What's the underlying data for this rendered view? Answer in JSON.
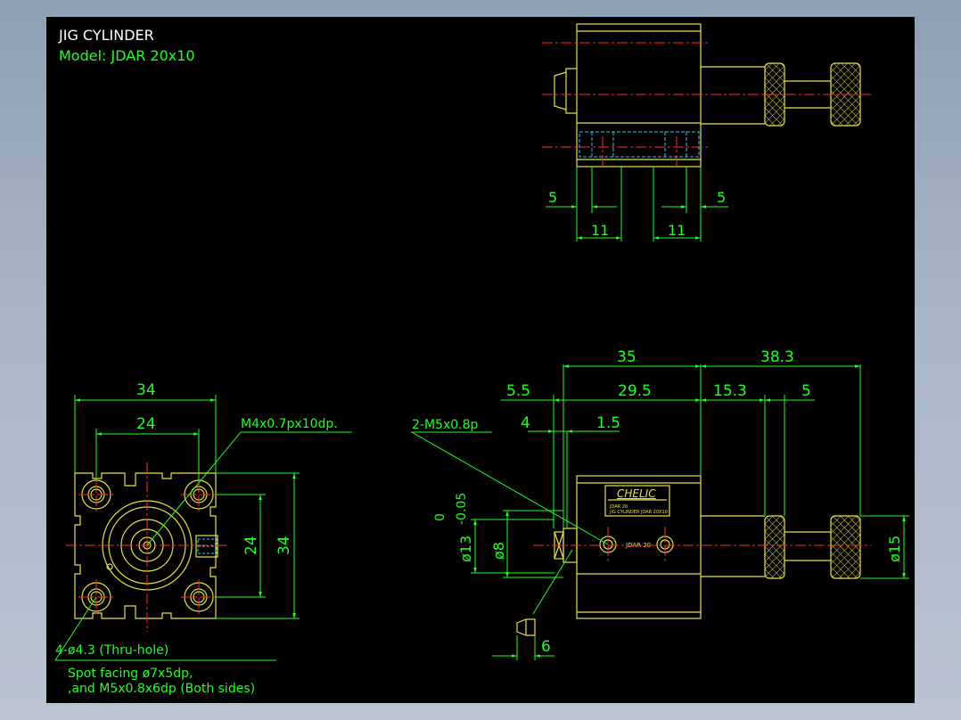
{
  "title": {
    "line1": "JIG CYLINDER",
    "line2": "Model:  JDAR 20x10"
  },
  "colors": {
    "background": "#000000",
    "outline": "#e8e04a",
    "dimension": "#22ff22",
    "centerline": "#ff2a2a",
    "hidden": "#33c8ff",
    "frame": "#a9b6c6"
  },
  "front_view": {
    "dims": {
      "outer_width": "34",
      "hole_pitch_x": "24",
      "hole_pitch_y": "24",
      "outer_height": "34"
    },
    "callout_port": "M4x0.7px10dp.",
    "callout_holes": "4-ø4.3 (Thru-hole)",
    "note_line1": "Spot facing ø7x5dp,",
    "note_line2": ",and M5x0.8x6dp (Both sides)"
  },
  "top_view": {
    "dims": {
      "left_offset": "5",
      "left_span": "11",
      "right_offset": "5",
      "right_span": "11"
    }
  },
  "side_view": {
    "dims": {
      "body_length": "35",
      "rod_extension": "38.3",
      "left_offset": "5.5",
      "inner_length": "29.5",
      "rod_seg1": "15.3",
      "rod_seg2": "5",
      "port_offset": "4",
      "port_gap": "1.5",
      "bore_tol_upper": "0",
      "bore_tol_lower": "-0.05",
      "bore_dia": "ø13",
      "boss_dia": "ø8",
      "knob_dia": "ø15",
      "fitting": "6"
    },
    "callout_ports": "2-M5x0.8p",
    "label_brand": "CHELIC",
    "label_line1": "JDAR 20",
    "label_line2": "JIG CYLINDER JDAR 20X10",
    "stamp": "JDAR 20"
  }
}
